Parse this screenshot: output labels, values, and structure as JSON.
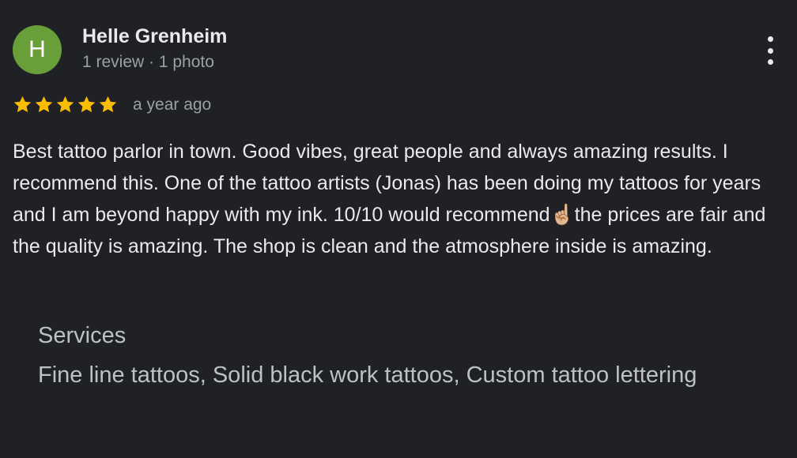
{
  "review": {
    "author": {
      "initial": "H",
      "name": "Helle Grenheim",
      "meta": "1 review · 1 photo",
      "avatar_color": "#689f38"
    },
    "rating": {
      "stars": 5,
      "max": 5,
      "star_color": "#fbbc04",
      "star_icon": "star-icon"
    },
    "time": "a year ago",
    "more_icon": "more-vert-icon",
    "text": "Best tattoo parlor in town. Good vibes, great people and always amazing results. I recommend this. One of the tattoo artists (Jonas) has been doing my tattoos for years and I am beyond happy with my ink. 10/10 would recommend☝🏼the prices are fair and the quality is amazing. The shop is clean and the atmosphere inside is amazing.",
    "services": {
      "label": "Services",
      "value": "Fine line tattoos, Solid black work tattoos, Custom tattoo lettering"
    }
  }
}
